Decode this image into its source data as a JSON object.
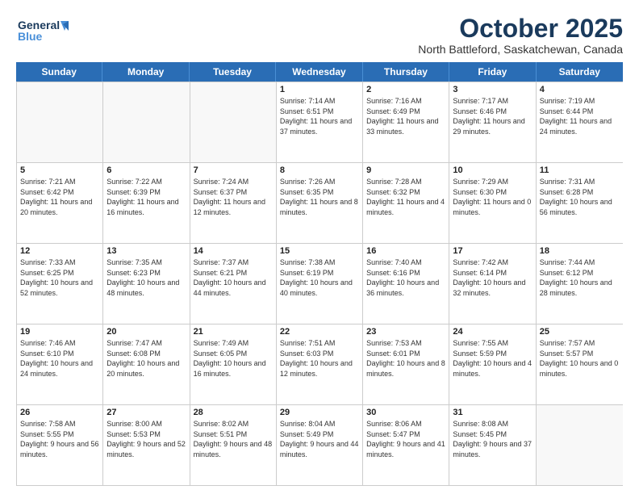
{
  "header": {
    "logo_general": "General",
    "logo_blue": "Blue",
    "month_title": "October 2025",
    "location": "North Battleford, Saskatchewan, Canada"
  },
  "days_of_week": [
    "Sunday",
    "Monday",
    "Tuesday",
    "Wednesday",
    "Thursday",
    "Friday",
    "Saturday"
  ],
  "weeks": [
    [
      {
        "day": "",
        "empty": true
      },
      {
        "day": "",
        "empty": true
      },
      {
        "day": "",
        "empty": true
      },
      {
        "day": "1",
        "sunrise": "7:14 AM",
        "sunset": "6:51 PM",
        "daylight": "11 hours and 37 minutes."
      },
      {
        "day": "2",
        "sunrise": "7:16 AM",
        "sunset": "6:49 PM",
        "daylight": "11 hours and 33 minutes."
      },
      {
        "day": "3",
        "sunrise": "7:17 AM",
        "sunset": "6:46 PM",
        "daylight": "11 hours and 29 minutes."
      },
      {
        "day": "4",
        "sunrise": "7:19 AM",
        "sunset": "6:44 PM",
        "daylight": "11 hours and 24 minutes."
      }
    ],
    [
      {
        "day": "5",
        "sunrise": "7:21 AM",
        "sunset": "6:42 PM",
        "daylight": "11 hours and 20 minutes."
      },
      {
        "day": "6",
        "sunrise": "7:22 AM",
        "sunset": "6:39 PM",
        "daylight": "11 hours and 16 minutes."
      },
      {
        "day": "7",
        "sunrise": "7:24 AM",
        "sunset": "6:37 PM",
        "daylight": "11 hours and 12 minutes."
      },
      {
        "day": "8",
        "sunrise": "7:26 AM",
        "sunset": "6:35 PM",
        "daylight": "11 hours and 8 minutes."
      },
      {
        "day": "9",
        "sunrise": "7:28 AM",
        "sunset": "6:32 PM",
        "daylight": "11 hours and 4 minutes."
      },
      {
        "day": "10",
        "sunrise": "7:29 AM",
        "sunset": "6:30 PM",
        "daylight": "11 hours and 0 minutes."
      },
      {
        "day": "11",
        "sunrise": "7:31 AM",
        "sunset": "6:28 PM",
        "daylight": "10 hours and 56 minutes."
      }
    ],
    [
      {
        "day": "12",
        "sunrise": "7:33 AM",
        "sunset": "6:25 PM",
        "daylight": "10 hours and 52 minutes."
      },
      {
        "day": "13",
        "sunrise": "7:35 AM",
        "sunset": "6:23 PM",
        "daylight": "10 hours and 48 minutes."
      },
      {
        "day": "14",
        "sunrise": "7:37 AM",
        "sunset": "6:21 PM",
        "daylight": "10 hours and 44 minutes."
      },
      {
        "day": "15",
        "sunrise": "7:38 AM",
        "sunset": "6:19 PM",
        "daylight": "10 hours and 40 minutes."
      },
      {
        "day": "16",
        "sunrise": "7:40 AM",
        "sunset": "6:16 PM",
        "daylight": "10 hours and 36 minutes."
      },
      {
        "day": "17",
        "sunrise": "7:42 AM",
        "sunset": "6:14 PM",
        "daylight": "10 hours and 32 minutes."
      },
      {
        "day": "18",
        "sunrise": "7:44 AM",
        "sunset": "6:12 PM",
        "daylight": "10 hours and 28 minutes."
      }
    ],
    [
      {
        "day": "19",
        "sunrise": "7:46 AM",
        "sunset": "6:10 PM",
        "daylight": "10 hours and 24 minutes."
      },
      {
        "day": "20",
        "sunrise": "7:47 AM",
        "sunset": "6:08 PM",
        "daylight": "10 hours and 20 minutes."
      },
      {
        "day": "21",
        "sunrise": "7:49 AM",
        "sunset": "6:05 PM",
        "daylight": "10 hours and 16 minutes."
      },
      {
        "day": "22",
        "sunrise": "7:51 AM",
        "sunset": "6:03 PM",
        "daylight": "10 hours and 12 minutes."
      },
      {
        "day": "23",
        "sunrise": "7:53 AM",
        "sunset": "6:01 PM",
        "daylight": "10 hours and 8 minutes."
      },
      {
        "day": "24",
        "sunrise": "7:55 AM",
        "sunset": "5:59 PM",
        "daylight": "10 hours and 4 minutes."
      },
      {
        "day": "25",
        "sunrise": "7:57 AM",
        "sunset": "5:57 PM",
        "daylight": "10 hours and 0 minutes."
      }
    ],
    [
      {
        "day": "26",
        "sunrise": "7:58 AM",
        "sunset": "5:55 PM",
        "daylight": "9 hours and 56 minutes."
      },
      {
        "day": "27",
        "sunrise": "8:00 AM",
        "sunset": "5:53 PM",
        "daylight": "9 hours and 52 minutes."
      },
      {
        "day": "28",
        "sunrise": "8:02 AM",
        "sunset": "5:51 PM",
        "daylight": "9 hours and 48 minutes."
      },
      {
        "day": "29",
        "sunrise": "8:04 AM",
        "sunset": "5:49 PM",
        "daylight": "9 hours and 44 minutes."
      },
      {
        "day": "30",
        "sunrise": "8:06 AM",
        "sunset": "5:47 PM",
        "daylight": "9 hours and 41 minutes."
      },
      {
        "day": "31",
        "sunrise": "8:08 AM",
        "sunset": "5:45 PM",
        "daylight": "9 hours and 37 minutes."
      },
      {
        "day": "",
        "empty": true
      }
    ]
  ]
}
